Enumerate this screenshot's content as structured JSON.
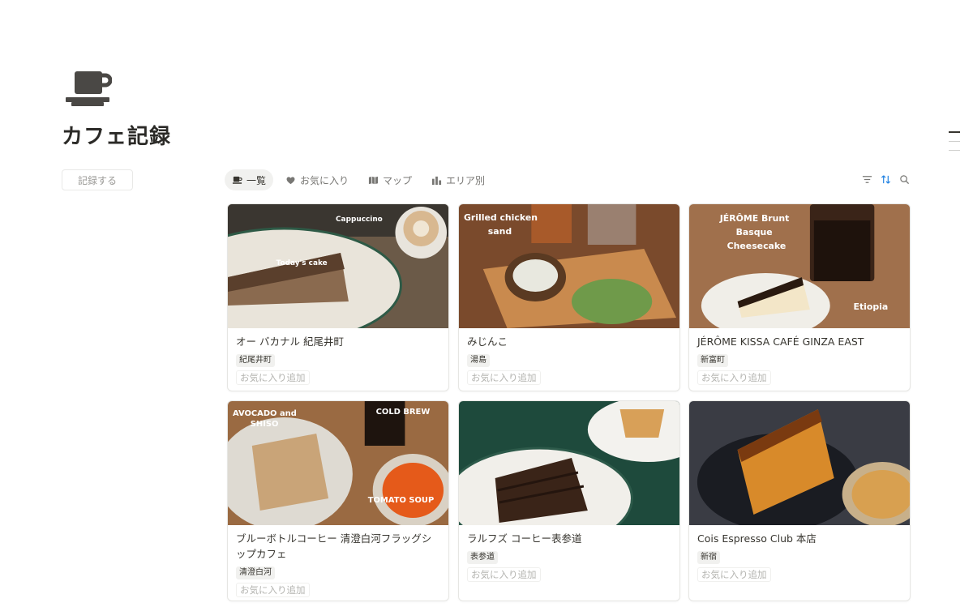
{
  "page": {
    "icon": "coffee-cup-icon",
    "title": "カフェ記録"
  },
  "sidebar": {
    "button_label": "記録する"
  },
  "tabs": [
    {
      "label": "一覧",
      "icon": "coffee-cup-icon",
      "active": true
    },
    {
      "label": "お気に入り",
      "icon": "heart-icon",
      "active": false
    },
    {
      "label": "マップ",
      "icon": "map-icon",
      "active": false
    },
    {
      "label": "エリア別",
      "icon": "bar-chart-icon",
      "active": false
    }
  ],
  "toolbar": {
    "icons": [
      "filter-icon",
      "sort-icon",
      "search-icon"
    ],
    "accent": "#2383e2"
  },
  "cards": [
    {
      "name": "オー バカナル 紀尾井町",
      "tag": "紀尾井町",
      "fav_label": "お気に入り追加",
      "annotations": [
        "Cappuccino",
        "Today's cake"
      ]
    },
    {
      "name": "みじんこ",
      "tag": "湯島",
      "fav_label": "お気に入り追加",
      "annotations": [
        "Grilled chicken",
        "sand"
      ]
    },
    {
      "name": "JÉRÔME KISSA CAFÉ GINZA EAST",
      "tag": "新富町",
      "fav_label": "お気に入り追加",
      "annotations": [
        "JÉRÔME Brunt",
        "Basque",
        "Cheesecake",
        "Etiopia"
      ]
    },
    {
      "name": "ブルーボトルコーヒー 清澄白河フラッグシップカフェ",
      "tag": "清澄白河",
      "fav_label": "お気に入り追加",
      "annotations": [
        "AVOCADO and",
        "SHISO",
        "COLD BREW",
        "TOMATO SOUP"
      ]
    },
    {
      "name": "ラルフズ コーヒー表参道",
      "tag": "表参道",
      "fav_label": "お気に入り追加",
      "annotations": []
    },
    {
      "name": "Cois Espresso Club 本店",
      "tag": "新宿",
      "fav_label": "お気に入り追加",
      "annotations": []
    }
  ]
}
